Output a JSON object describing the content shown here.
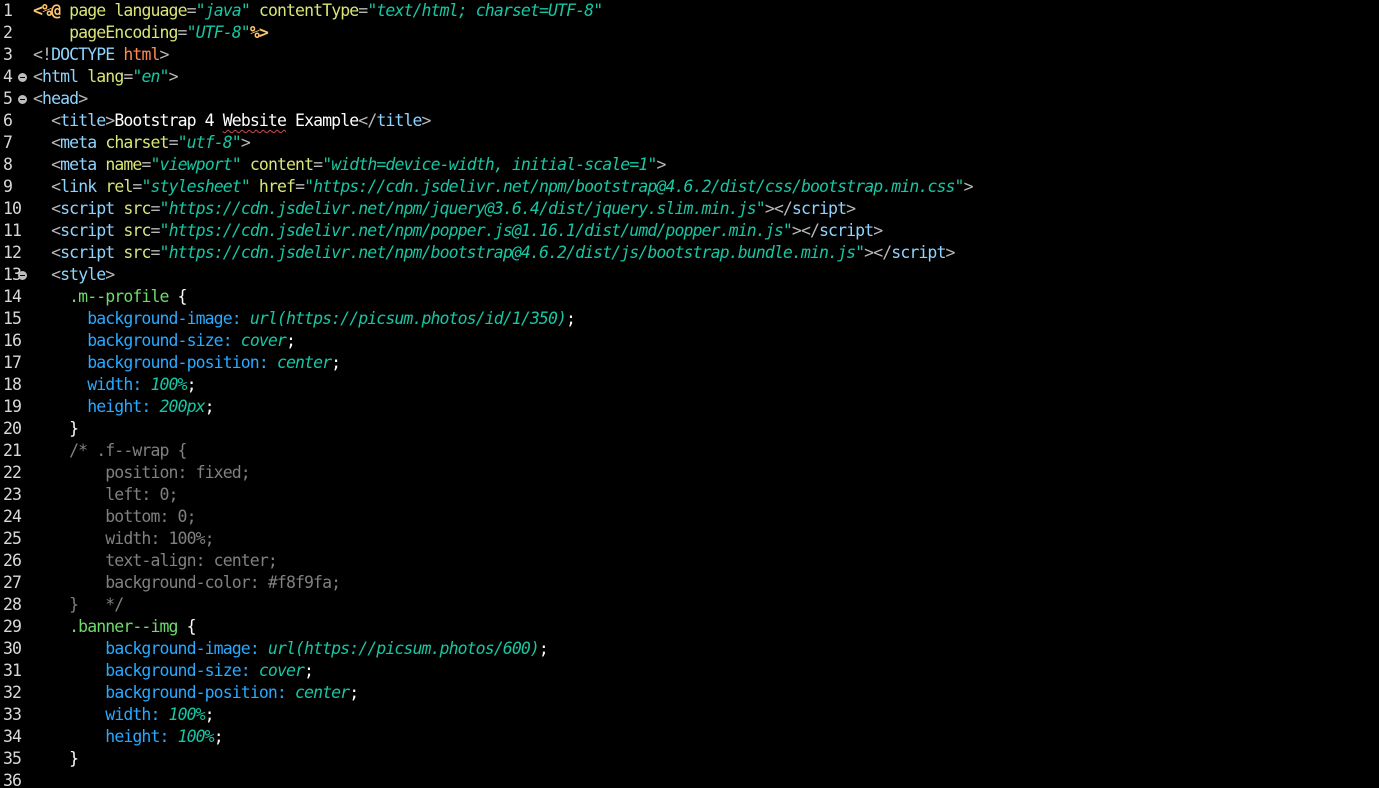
{
  "editor": {
    "colors": {
      "background": "#000000",
      "line_number": "#d8d8d8",
      "jsp_directive": "#ffc66d",
      "tag": "#8fd4ff",
      "attribute": "#d9e577",
      "string": "#17c6a3",
      "css_selector": "#6ddc6d",
      "css_property": "#29a9ff",
      "comment": "#808080",
      "doctype": "#ff8b50"
    },
    "lines": [
      {
        "num": "1",
        "fold": false,
        "tokens": [
          {
            "t": "<%@",
            "k": "directive"
          },
          {
            "t": " ",
            "k": "plain"
          },
          {
            "t": "page",
            "k": "jspattr"
          },
          {
            "t": " ",
            "k": "plain"
          },
          {
            "t": "language",
            "k": "attr"
          },
          {
            "t": "=",
            "k": "punct"
          },
          {
            "t": "\"java\"",
            "k": "str"
          },
          {
            "t": " ",
            "k": "plain"
          },
          {
            "t": "contentType",
            "k": "attr"
          },
          {
            "t": "=",
            "k": "punct"
          },
          {
            "t": "\"text/html; charset=UTF-8\"",
            "k": "str"
          }
        ]
      },
      {
        "num": "2",
        "fold": false,
        "tokens": [
          {
            "t": "    ",
            "k": "plain"
          },
          {
            "t": "pageEncoding",
            "k": "attr"
          },
          {
            "t": "=",
            "k": "punct"
          },
          {
            "t": "\"UTF-8\"",
            "k": "str"
          },
          {
            "t": "%>",
            "k": "directive"
          }
        ]
      },
      {
        "num": "3",
        "fold": false,
        "tokens": [
          {
            "t": "<!",
            "k": "punct"
          },
          {
            "t": "DOCTYPE",
            "k": "tag"
          },
          {
            "t": " ",
            "k": "plain"
          },
          {
            "t": "html",
            "k": "doctype"
          },
          {
            "t": ">",
            "k": "punct"
          }
        ]
      },
      {
        "num": "4",
        "fold": true,
        "tokens": [
          {
            "t": "<",
            "k": "punct"
          },
          {
            "t": "html",
            "k": "tag"
          },
          {
            "t": " ",
            "k": "plain"
          },
          {
            "t": "lang",
            "k": "attr"
          },
          {
            "t": "=",
            "k": "punct"
          },
          {
            "t": "\"en\"",
            "k": "str"
          },
          {
            "t": ">",
            "k": "punct"
          }
        ]
      },
      {
        "num": "5",
        "fold": true,
        "tokens": [
          {
            "t": "<",
            "k": "punct"
          },
          {
            "t": "head",
            "k": "tag"
          },
          {
            "t": ">",
            "k": "punct"
          }
        ]
      },
      {
        "num": "6",
        "fold": false,
        "tokens": [
          {
            "t": "  ",
            "k": "plain"
          },
          {
            "t": "<",
            "k": "punct"
          },
          {
            "t": "title",
            "k": "tag"
          },
          {
            "t": ">",
            "k": "punct"
          },
          {
            "t": "Bootstrap 4 ",
            "k": "text"
          },
          {
            "t": "Website",
            "k": "squiggle"
          },
          {
            "t": " Example",
            "k": "text"
          },
          {
            "t": "</",
            "k": "punct"
          },
          {
            "t": "title",
            "k": "tag"
          },
          {
            "t": ">",
            "k": "punct"
          }
        ]
      },
      {
        "num": "7",
        "fold": false,
        "tokens": [
          {
            "t": "  ",
            "k": "plain"
          },
          {
            "t": "<",
            "k": "punct"
          },
          {
            "t": "meta",
            "k": "tag"
          },
          {
            "t": " ",
            "k": "plain"
          },
          {
            "t": "charset",
            "k": "attr"
          },
          {
            "t": "=",
            "k": "punct"
          },
          {
            "t": "\"utf-8\"",
            "k": "str"
          },
          {
            "t": ">",
            "k": "punct"
          }
        ]
      },
      {
        "num": "8",
        "fold": false,
        "tokens": [
          {
            "t": "  ",
            "k": "plain"
          },
          {
            "t": "<",
            "k": "punct"
          },
          {
            "t": "meta",
            "k": "tag"
          },
          {
            "t": " ",
            "k": "plain"
          },
          {
            "t": "name",
            "k": "attr"
          },
          {
            "t": "=",
            "k": "punct"
          },
          {
            "t": "\"viewport\"",
            "k": "str"
          },
          {
            "t": " ",
            "k": "plain"
          },
          {
            "t": "content",
            "k": "attr"
          },
          {
            "t": "=",
            "k": "punct"
          },
          {
            "t": "\"width=device-width, initial-scale=1\"",
            "k": "str"
          },
          {
            "t": ">",
            "k": "punct"
          }
        ]
      },
      {
        "num": "9",
        "fold": false,
        "tokens": [
          {
            "t": "  ",
            "k": "plain"
          },
          {
            "t": "<",
            "k": "punct"
          },
          {
            "t": "link",
            "k": "tag"
          },
          {
            "t": " ",
            "k": "plain"
          },
          {
            "t": "rel",
            "k": "attr"
          },
          {
            "t": "=",
            "k": "punct"
          },
          {
            "t": "\"stylesheet\"",
            "k": "str"
          },
          {
            "t": " ",
            "k": "plain"
          },
          {
            "t": "href",
            "k": "attr"
          },
          {
            "t": "=",
            "k": "punct"
          },
          {
            "t": "\"https://cdn.jsdelivr.net/npm/bootstrap@4.6.2/dist/css/bootstrap.min.css\"",
            "k": "str"
          },
          {
            "t": ">",
            "k": "punct"
          }
        ]
      },
      {
        "num": "10",
        "fold": false,
        "tokens": [
          {
            "t": "  ",
            "k": "plain"
          },
          {
            "t": "<",
            "k": "punct"
          },
          {
            "t": "script",
            "k": "tag"
          },
          {
            "t": " ",
            "k": "plain"
          },
          {
            "t": "src",
            "k": "attr"
          },
          {
            "t": "=",
            "k": "punct"
          },
          {
            "t": "\"https://cdn.jsdelivr.net/npm/jquery@3.6.4/dist/jquery.slim.min.js\"",
            "k": "str"
          },
          {
            "t": "></",
            "k": "punct"
          },
          {
            "t": "script",
            "k": "tag"
          },
          {
            "t": ">",
            "k": "punct"
          }
        ]
      },
      {
        "num": "11",
        "fold": false,
        "tokens": [
          {
            "t": "  ",
            "k": "plain"
          },
          {
            "t": "<",
            "k": "punct"
          },
          {
            "t": "script",
            "k": "tag"
          },
          {
            "t": " ",
            "k": "plain"
          },
          {
            "t": "src",
            "k": "attr"
          },
          {
            "t": "=",
            "k": "punct"
          },
          {
            "t": "\"https://cdn.jsdelivr.net/npm/popper.js@1.16.1/dist/umd/popper.min.js\"",
            "k": "str"
          },
          {
            "t": "></",
            "k": "punct"
          },
          {
            "t": "script",
            "k": "tag"
          },
          {
            "t": ">",
            "k": "punct"
          }
        ]
      },
      {
        "num": "12",
        "fold": false,
        "tokens": [
          {
            "t": "  ",
            "k": "plain"
          },
          {
            "t": "<",
            "k": "punct"
          },
          {
            "t": "script",
            "k": "tag"
          },
          {
            "t": " ",
            "k": "plain"
          },
          {
            "t": "src",
            "k": "attr"
          },
          {
            "t": "=",
            "k": "punct"
          },
          {
            "t": "\"https://cdn.jsdelivr.net/npm/bootstrap@4.6.2/dist/js/bootstrap.bundle.min.js\"",
            "k": "str"
          },
          {
            "t": "></",
            "k": "punct"
          },
          {
            "t": "script",
            "k": "tag"
          },
          {
            "t": ">",
            "k": "punct"
          }
        ]
      },
      {
        "num": "13",
        "fold": true,
        "tokens": [
          {
            "t": "  ",
            "k": "plain"
          },
          {
            "t": "<",
            "k": "punct"
          },
          {
            "t": "style",
            "k": "tag"
          },
          {
            "t": ">",
            "k": "punct"
          }
        ]
      },
      {
        "num": "14",
        "fold": false,
        "tokens": [
          {
            "t": "    ",
            "k": "plain"
          },
          {
            "t": ".m--profile",
            "k": "selector"
          },
          {
            "t": " {",
            "k": "brace"
          }
        ]
      },
      {
        "num": "15",
        "fold": false,
        "tokens": [
          {
            "t": "      ",
            "k": "plain"
          },
          {
            "t": "background-image:",
            "k": "prop"
          },
          {
            "t": " ",
            "k": "plain"
          },
          {
            "t": "url(https://picsum.photos/id/1/350)",
            "k": "value"
          },
          {
            "t": ";",
            "k": "brace"
          }
        ]
      },
      {
        "num": "16",
        "fold": false,
        "tokens": [
          {
            "t": "      ",
            "k": "plain"
          },
          {
            "t": "background-size:",
            "k": "prop"
          },
          {
            "t": " ",
            "k": "plain"
          },
          {
            "t": "cover",
            "k": "value"
          },
          {
            "t": ";",
            "k": "brace"
          }
        ]
      },
      {
        "num": "17",
        "fold": false,
        "tokens": [
          {
            "t": "      ",
            "k": "plain"
          },
          {
            "t": "background-position:",
            "k": "prop"
          },
          {
            "t": " ",
            "k": "plain"
          },
          {
            "t": "center",
            "k": "value"
          },
          {
            "t": ";",
            "k": "brace"
          }
        ]
      },
      {
        "num": "18",
        "fold": false,
        "tokens": [
          {
            "t": "      ",
            "k": "plain"
          },
          {
            "t": "width:",
            "k": "prop"
          },
          {
            "t": " ",
            "k": "plain"
          },
          {
            "t": "100%",
            "k": "value"
          },
          {
            "t": ";",
            "k": "brace"
          }
        ]
      },
      {
        "num": "19",
        "fold": false,
        "tokens": [
          {
            "t": "      ",
            "k": "plain"
          },
          {
            "t": "height:",
            "k": "prop"
          },
          {
            "t": " ",
            "k": "plain"
          },
          {
            "t": "200px",
            "k": "value"
          },
          {
            "t": ";",
            "k": "brace"
          }
        ]
      },
      {
        "num": "20",
        "fold": false,
        "tokens": [
          {
            "t": "    ",
            "k": "plain"
          },
          {
            "t": "}",
            "k": "brace"
          }
        ]
      },
      {
        "num": "21",
        "fold": false,
        "tokens": [
          {
            "t": "    ",
            "k": "plain"
          },
          {
            "t": "/* .f--wrap {",
            "k": "comment"
          }
        ]
      },
      {
        "num": "22",
        "fold": false,
        "tokens": [
          {
            "t": "        position: fixed;",
            "k": "comment"
          }
        ]
      },
      {
        "num": "23",
        "fold": false,
        "tokens": [
          {
            "t": "        left: 0;",
            "k": "comment"
          }
        ]
      },
      {
        "num": "24",
        "fold": false,
        "tokens": [
          {
            "t": "        bottom: 0;",
            "k": "comment"
          }
        ]
      },
      {
        "num": "25",
        "fold": false,
        "tokens": [
          {
            "t": "        width: 100%;",
            "k": "comment"
          }
        ]
      },
      {
        "num": "26",
        "fold": false,
        "tokens": [
          {
            "t": "        text-align: center;",
            "k": "comment"
          }
        ]
      },
      {
        "num": "27",
        "fold": false,
        "tokens": [
          {
            "t": "        background-color: #f8f9fa;",
            "k": "comment"
          }
        ]
      },
      {
        "num": "28",
        "fold": false,
        "tokens": [
          {
            "t": "    }   */",
            "k": "comment"
          }
        ]
      },
      {
        "num": "29",
        "fold": false,
        "tokens": [
          {
            "t": "    ",
            "k": "plain"
          },
          {
            "t": ".banner--img",
            "k": "selector"
          },
          {
            "t": " {",
            "k": "brace"
          }
        ]
      },
      {
        "num": "30",
        "fold": false,
        "tokens": [
          {
            "t": "        ",
            "k": "plain"
          },
          {
            "t": "background-image:",
            "k": "prop"
          },
          {
            "t": " ",
            "k": "plain"
          },
          {
            "t": "url(https://picsum.photos/600)",
            "k": "value"
          },
          {
            "t": ";",
            "k": "brace"
          }
        ]
      },
      {
        "num": "31",
        "fold": false,
        "tokens": [
          {
            "t": "        ",
            "k": "plain"
          },
          {
            "t": "background-size:",
            "k": "prop"
          },
          {
            "t": " ",
            "k": "plain"
          },
          {
            "t": "cover",
            "k": "value"
          },
          {
            "t": ";",
            "k": "brace"
          }
        ]
      },
      {
        "num": "32",
        "fold": false,
        "tokens": [
          {
            "t": "        ",
            "k": "plain"
          },
          {
            "t": "background-position:",
            "k": "prop"
          },
          {
            "t": " ",
            "k": "plain"
          },
          {
            "t": "center",
            "k": "value"
          },
          {
            "t": ";",
            "k": "brace"
          }
        ]
      },
      {
        "num": "33",
        "fold": false,
        "tokens": [
          {
            "t": "        ",
            "k": "plain"
          },
          {
            "t": "width:",
            "k": "prop"
          },
          {
            "t": " ",
            "k": "plain"
          },
          {
            "t": "100%",
            "k": "value"
          },
          {
            "t": ";",
            "k": "brace"
          }
        ]
      },
      {
        "num": "34",
        "fold": false,
        "tokens": [
          {
            "t": "        ",
            "k": "plain"
          },
          {
            "t": "height:",
            "k": "prop"
          },
          {
            "t": " ",
            "k": "plain"
          },
          {
            "t": "100%",
            "k": "value"
          },
          {
            "t": ";",
            "k": "brace"
          }
        ]
      },
      {
        "num": "35",
        "fold": false,
        "tokens": [
          {
            "t": "    ",
            "k": "plain"
          },
          {
            "t": "}",
            "k": "brace"
          }
        ]
      },
      {
        "num": "36",
        "fold": false,
        "tokens": []
      }
    ]
  }
}
